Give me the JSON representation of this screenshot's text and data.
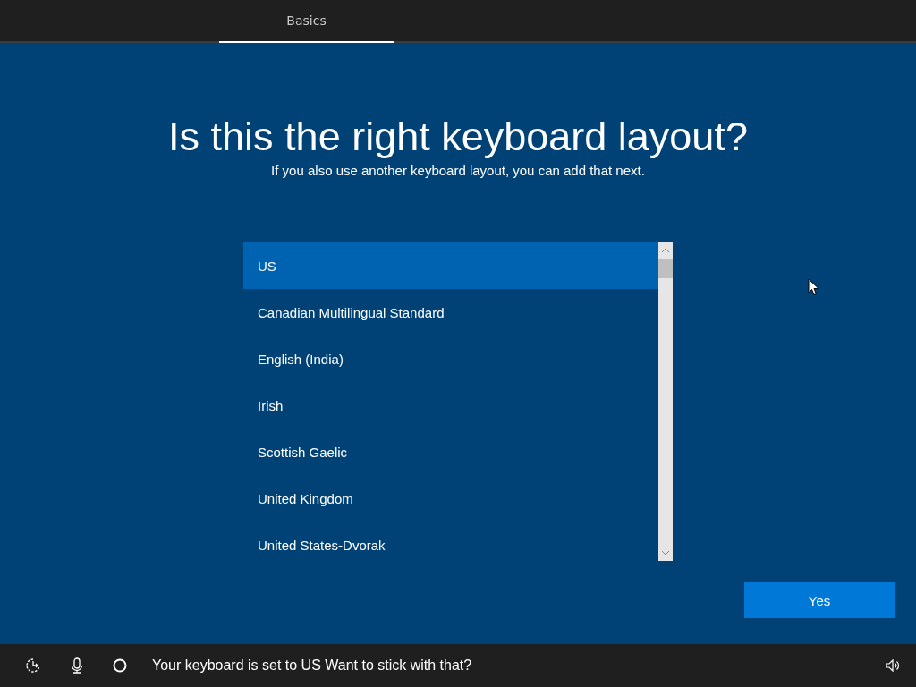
{
  "tabs": [
    {
      "label": "Basics",
      "selected": true
    }
  ],
  "title": "Is this the right keyboard layout?",
  "subtitle": "If you also use another keyboard layout, you can add that next.",
  "layouts": [
    {
      "label": "US",
      "selected": true
    },
    {
      "label": "Canadian Multilingual Standard",
      "selected": false
    },
    {
      "label": "English (India)",
      "selected": false
    },
    {
      "label": "Irish",
      "selected": false
    },
    {
      "label": "Scottish Gaelic",
      "selected": false
    },
    {
      "label": "United Kingdom",
      "selected": false
    },
    {
      "label": "United States-Dvorak",
      "selected": false
    }
  ],
  "primary_button": "Yes",
  "status_bar": {
    "message": "Your keyboard is set to US Want to stick with that?"
  }
}
